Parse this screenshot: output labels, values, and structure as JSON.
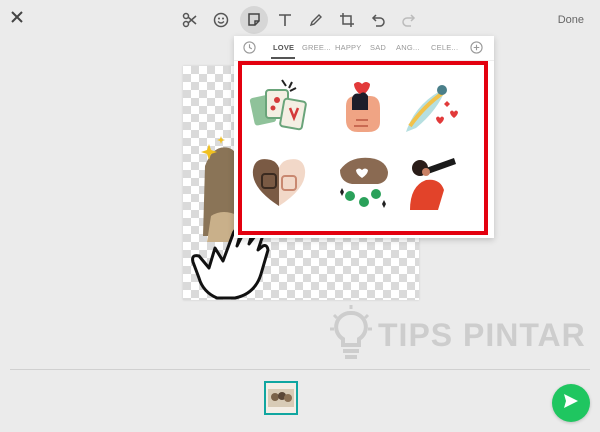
{
  "toolbar": {
    "close_icon": "close-icon",
    "tools": [
      "scissors-icon",
      "emoji-icon",
      "sticker-icon",
      "text-icon",
      "pencil-icon",
      "crop-rotate-icon",
      "undo-icon",
      "redo-icon"
    ],
    "active_tool": "sticker-icon",
    "done_label": "Done"
  },
  "sticker_panel": {
    "categories": [
      "LOVE",
      "GREE...",
      "HAPPY",
      "SAD",
      "ANG...",
      "CELE..."
    ],
    "active_category": "LOVE",
    "recent_icon": "clock-icon",
    "add_icon": "plus-circle-icon",
    "stickers": [
      "lucky-mahjong-sticker",
      "heart-hands-sticker",
      "love-birds-sticker",
      "heart-fist-bump-sticker",
      "money-hand-sticker",
      "telescope-person-sticker"
    ],
    "highlight_color": "#e3000f"
  },
  "watermark": {
    "text": "TIPS PINTAR"
  },
  "footer": {
    "thumbnail": "image-thumbnail",
    "send_icon": "send-icon",
    "send_color": "#1fc660"
  }
}
